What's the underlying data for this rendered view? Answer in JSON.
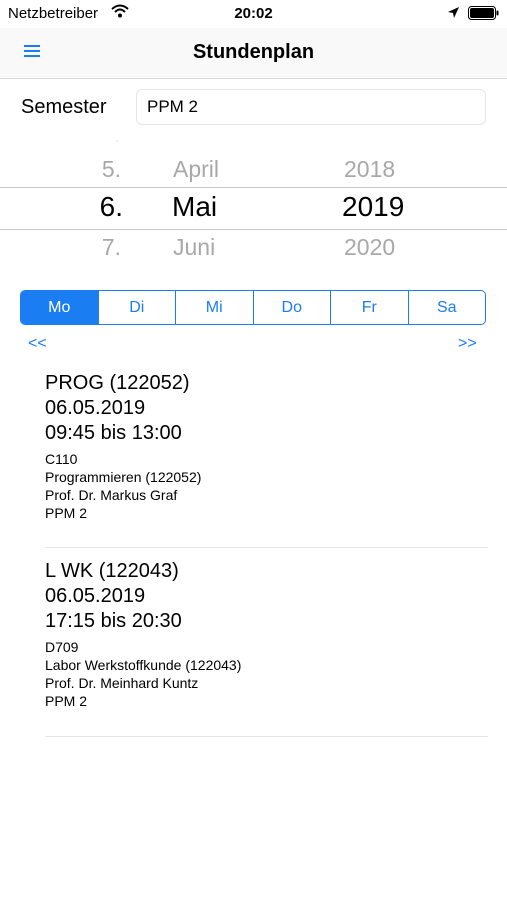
{
  "status_bar": {
    "carrier": "Netzbetreiber",
    "time": "20:02"
  },
  "nav": {
    "title": "Stundenplan"
  },
  "semester": {
    "label": "Semester",
    "value": "PPM 2"
  },
  "date_picker": {
    "days": [
      "5.",
      "6.",
      "7."
    ],
    "months": [
      "April",
      "Mai",
      "Juni"
    ],
    "years": [
      "2018",
      "2019",
      "2020"
    ]
  },
  "weekdays": {
    "selected": "Mo",
    "items": [
      {
        "label": "Mo"
      },
      {
        "label": "Di"
      },
      {
        "label": "Mi"
      },
      {
        "label": "Do"
      },
      {
        "label": "Fr"
      },
      {
        "label": "Sa"
      }
    ]
  },
  "navigation": {
    "prev": "<<",
    "next": ">>"
  },
  "lessons": [
    {
      "code": "PROG (122052)",
      "date": "06.05.2019",
      "time": "09:45 bis 13:00",
      "room": "C110",
      "course": "Programmieren (122052)",
      "lecturer": "Prof. Dr. Markus Graf",
      "group": "PPM 2"
    },
    {
      "code": "L WK (122043)",
      "date": "06.05.2019",
      "time": "17:15 bis 20:30",
      "room": "D709",
      "course": "Labor Werkstoffkunde (122043)",
      "lecturer": "Prof. Dr. Meinhard Kuntz",
      "group": "PPM 2"
    }
  ],
  "colors": {
    "accent": "#1a7df2",
    "separator": "#e6e6e6"
  }
}
